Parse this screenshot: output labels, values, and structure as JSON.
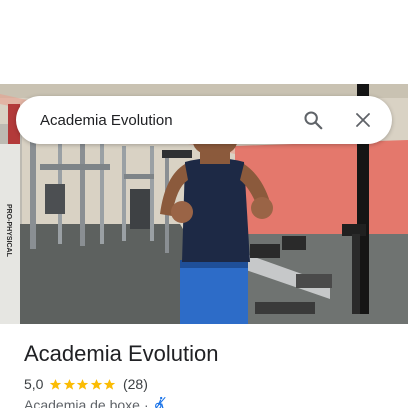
{
  "search": {
    "query": "Academia Evolution",
    "search_icon": "search-icon",
    "close_icon": "close-icon"
  },
  "hero": {
    "wall_sign_text": "PRO-PHYSICAL"
  },
  "place": {
    "name": "Academia Evolution",
    "rating": "5,0",
    "stars": 5,
    "review_count": "(28)",
    "category": "Academia de boxe",
    "separator": "·",
    "category_icon": "accessibility-icon"
  },
  "colors": {
    "star": "#fbbc04",
    "accessibility_icon": "#1a73e8",
    "text_primary": "#202124",
    "text_secondary": "#5f6368"
  }
}
